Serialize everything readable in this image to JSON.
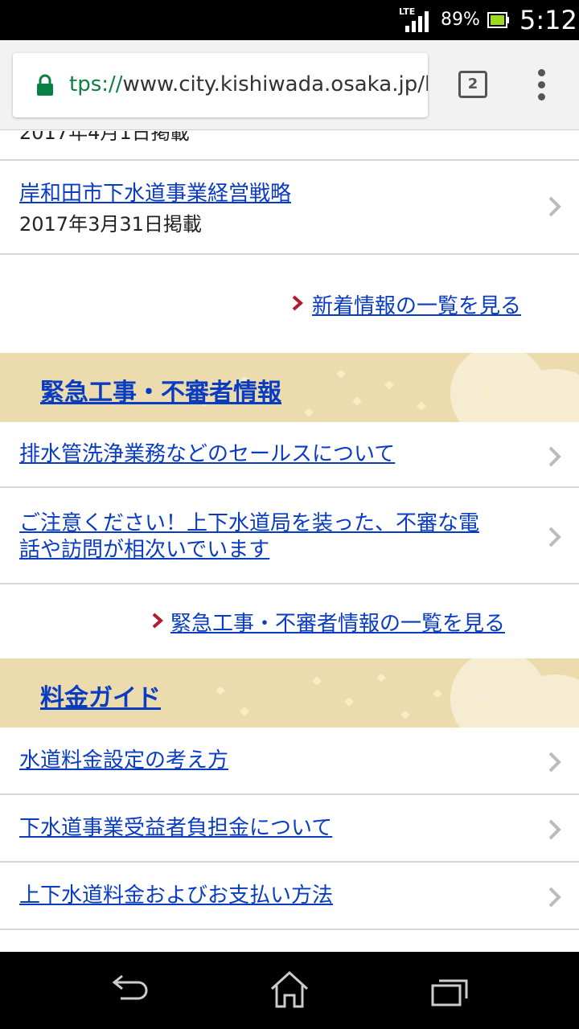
{
  "status_bar": {
    "network": "LTE",
    "battery_percent": "89%",
    "time": "5:12"
  },
  "browser": {
    "url_scheme": "tps://",
    "url_rest": "www.city.kishiwada.osaka.jp/l",
    "tab_count": "2"
  },
  "content": {
    "cut_top_text": "2017年4月1日掲載",
    "news_items": [
      {
        "title": "岸和田市下水道事業経営戦略",
        "date": "2017年3月31日掲載"
      }
    ],
    "news_more": "新着情報の一覧を見る",
    "emergency": {
      "title": "緊急工事・不審者情報",
      "items": [
        {
          "title": "排水管洗浄業務などのセールスについて"
        },
        {
          "title_line1": "ご注意ください！上下水道局を装った、不審な電",
          "title_line2": "話や訪問が相次いでいます"
        }
      ],
      "more": "緊急工事・不審者情報の一覧を見る"
    },
    "fees": {
      "title": "料金ガイド",
      "items": [
        {
          "title": "水道料金設定の考え方"
        },
        {
          "title": "下水道事業受益者負担金について"
        },
        {
          "title": "上下水道料金およびお支払い方法"
        }
      ]
    }
  },
  "colors": {
    "link": "#0a3cc2",
    "section_band": "#ecdcad",
    "more_arrow": "#b01c2e",
    "secure_lock": "#0b8043"
  }
}
